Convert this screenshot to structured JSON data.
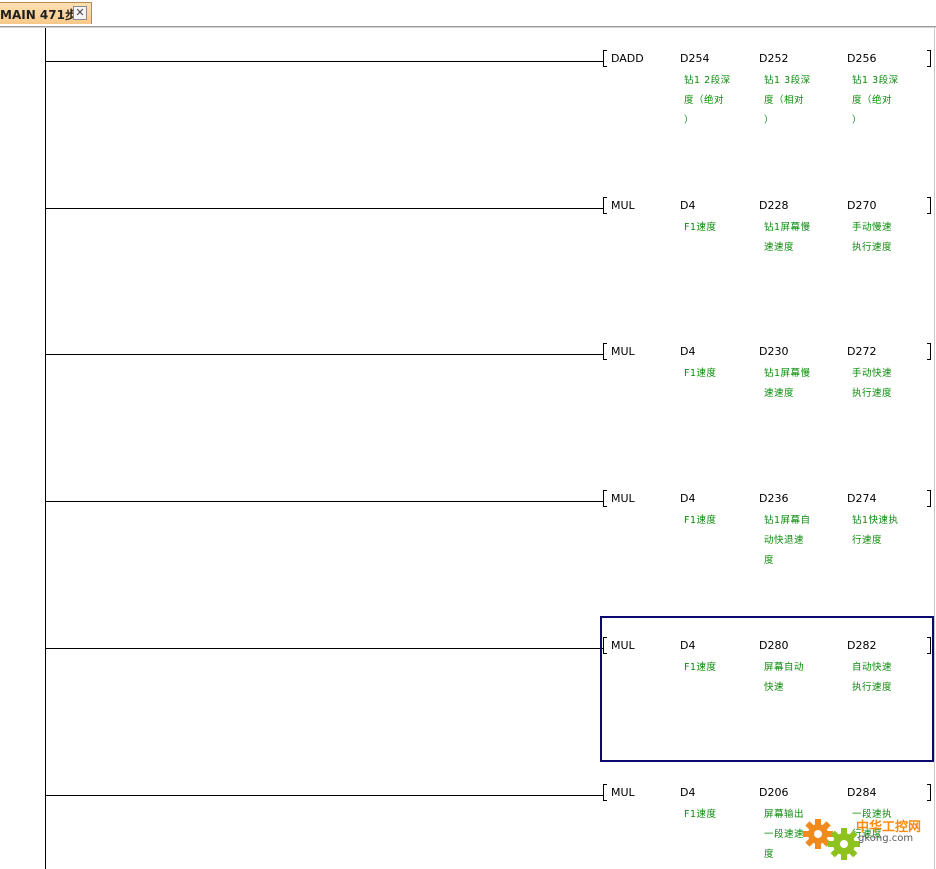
{
  "tab": {
    "title": "MAIN 471步",
    "close_label": "✕"
  },
  "rungs": [
    {
      "instruction": "DADD",
      "operands": [
        {
          "device": "D254",
          "comment": "钻1 2段深\n度（绝对\n）"
        },
        {
          "device": "D252",
          "comment": "钻1 3段深\n度（相对\n）"
        },
        {
          "device": "D256",
          "comment": "钻1 3段深\n度（绝对\n）"
        }
      ]
    },
    {
      "instruction": "MUL",
      "operands": [
        {
          "device": "D4",
          "comment": "F1速度"
        },
        {
          "device": "D228",
          "comment": "钻1屏幕慢\n速速度"
        },
        {
          "device": "D270",
          "comment": "手动慢速\n执行速度"
        }
      ]
    },
    {
      "instruction": "MUL",
      "operands": [
        {
          "device": "D4",
          "comment": "F1速度"
        },
        {
          "device": "D230",
          "comment": "钻1屏幕慢\n速速度"
        },
        {
          "device": "D272",
          "comment": "手动快速\n执行速度"
        }
      ]
    },
    {
      "instruction": "MUL",
      "operands": [
        {
          "device": "D4",
          "comment": "F1速度"
        },
        {
          "device": "D236",
          "comment": "钻1屏幕自\n动快退速\n度"
        },
        {
          "device": "D274",
          "comment": "钻1快速执\n行速度"
        }
      ]
    },
    {
      "instruction": "MUL",
      "operands": [
        {
          "device": "D4",
          "comment": "F1速度"
        },
        {
          "device": "D280",
          "comment": "屏幕自动\n快速"
        },
        {
          "device": "D282",
          "comment": "自动快速\n执行速度"
        }
      ]
    },
    {
      "instruction": "MUL",
      "operands": [
        {
          "device": "D4",
          "comment": "F1速度"
        },
        {
          "device": "D206",
          "comment": "屏幕输出\n一段速速\n度"
        },
        {
          "device": "D284",
          "comment": "一段速执\n行速度"
        }
      ]
    }
  ],
  "watermark": {
    "name": "中华工控网",
    "site": "gkong.com"
  },
  "colors": {
    "comment": "#0a8a0a",
    "selection": "#0a0a6e",
    "tab": "#f8c888"
  }
}
